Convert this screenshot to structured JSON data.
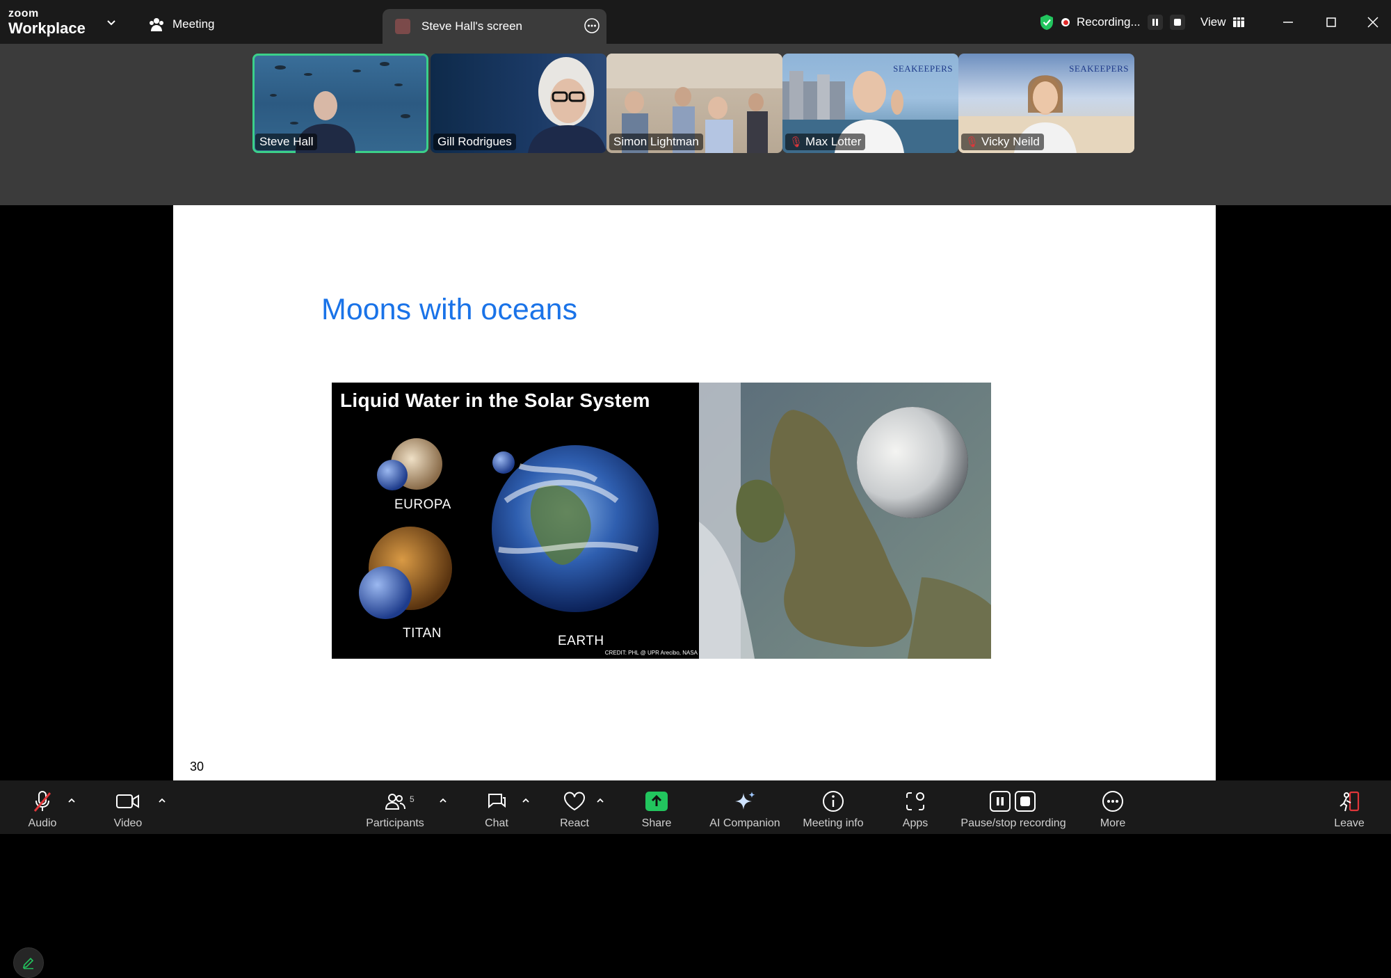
{
  "app": {
    "brand_top": "zoom",
    "brand_bottom": "Workplace"
  },
  "titlebar": {
    "meeting_label": "Meeting",
    "screen_tab_label": "Steve Hall's screen",
    "recording_label": "Recording...",
    "view_label": "View"
  },
  "participants": [
    {
      "name": "Steve Hall",
      "muted": false,
      "active": true
    },
    {
      "name": "Gill Rodrigues",
      "muted": false,
      "active": false
    },
    {
      "name": "Simon Lightman",
      "muted": false,
      "active": false
    },
    {
      "name": "Max Lotter",
      "muted": true,
      "active": false
    },
    {
      "name": "Vicky Neild",
      "muted": true,
      "active": false
    }
  ],
  "tile_logo_text": "SEAKEEPERS",
  "slide": {
    "title": "Moons with oceans",
    "page_number": "30",
    "image_title": "Liquid Water in the Solar System",
    "labels": {
      "europa": "EUROPA",
      "titan": "TITAN",
      "earth": "EARTH"
    },
    "credit": "CREDIT: PHL @ UPR Arecibo, NASA"
  },
  "toolbar": {
    "audio": "Audio",
    "video": "Video",
    "participants": "Participants",
    "participants_count": "5",
    "chat": "Chat",
    "react": "React",
    "share": "Share",
    "ai_companion": "AI Companion",
    "meeting_info": "Meeting info",
    "apps": "Apps",
    "pause_stop": "Pause/stop recording",
    "more": "More",
    "leave": "Leave"
  },
  "colors": {
    "accent_green": "#22c55e",
    "slide_title_blue": "#1a73e8",
    "active_border": "#3bd08a",
    "leave_red": "#e0363a"
  }
}
